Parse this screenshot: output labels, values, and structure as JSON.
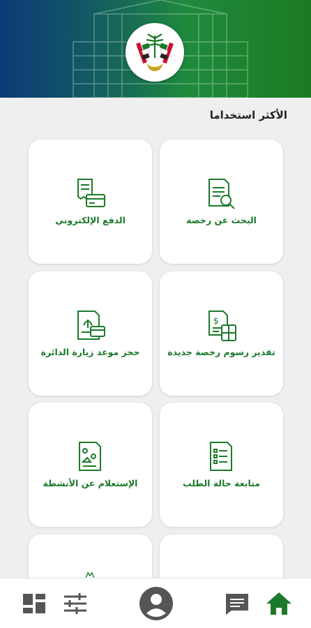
{
  "header": {
    "emblem_icon": "uae-emblem-icon",
    "background_gradient": [
      "#0c3a78",
      "#1f8a3d",
      "#1c7a22"
    ]
  },
  "section": {
    "title": "الأكثر استخداما"
  },
  "services": [
    {
      "label": "البحث عن رخصة",
      "icon": "document-search-icon"
    },
    {
      "label": "الدفع الإلكتروني",
      "icon": "receipt-card-icon"
    },
    {
      "label": "تقدير رسوم رخصة جديدة",
      "icon": "fee-calculator-icon"
    },
    {
      "label": "حجز موعد زيارة الدائرة",
      "icon": "appointment-document-icon"
    },
    {
      "label": "متابعة حالة الطلب",
      "icon": "checklist-document-icon"
    },
    {
      "label": "الإستعلام عن الأنشطة",
      "icon": "activities-document-icon"
    },
    {
      "label": "",
      "icon": ""
    },
    {
      "label": "",
      "icon": "partial-green-icon"
    }
  ],
  "bottom_nav": [
    {
      "name": "dashboard",
      "icon": "dashboard-icon"
    },
    {
      "name": "filters",
      "icon": "tune-icon"
    },
    {
      "name": "profile",
      "icon": "account-circle-icon"
    },
    {
      "name": "messages",
      "icon": "message-icon"
    },
    {
      "name": "home",
      "icon": "home-icon",
      "active": true
    }
  ],
  "colors": {
    "accent": "#1b7a2a",
    "nav_icon": "#555555",
    "home_active": "#1b7a2a"
  }
}
